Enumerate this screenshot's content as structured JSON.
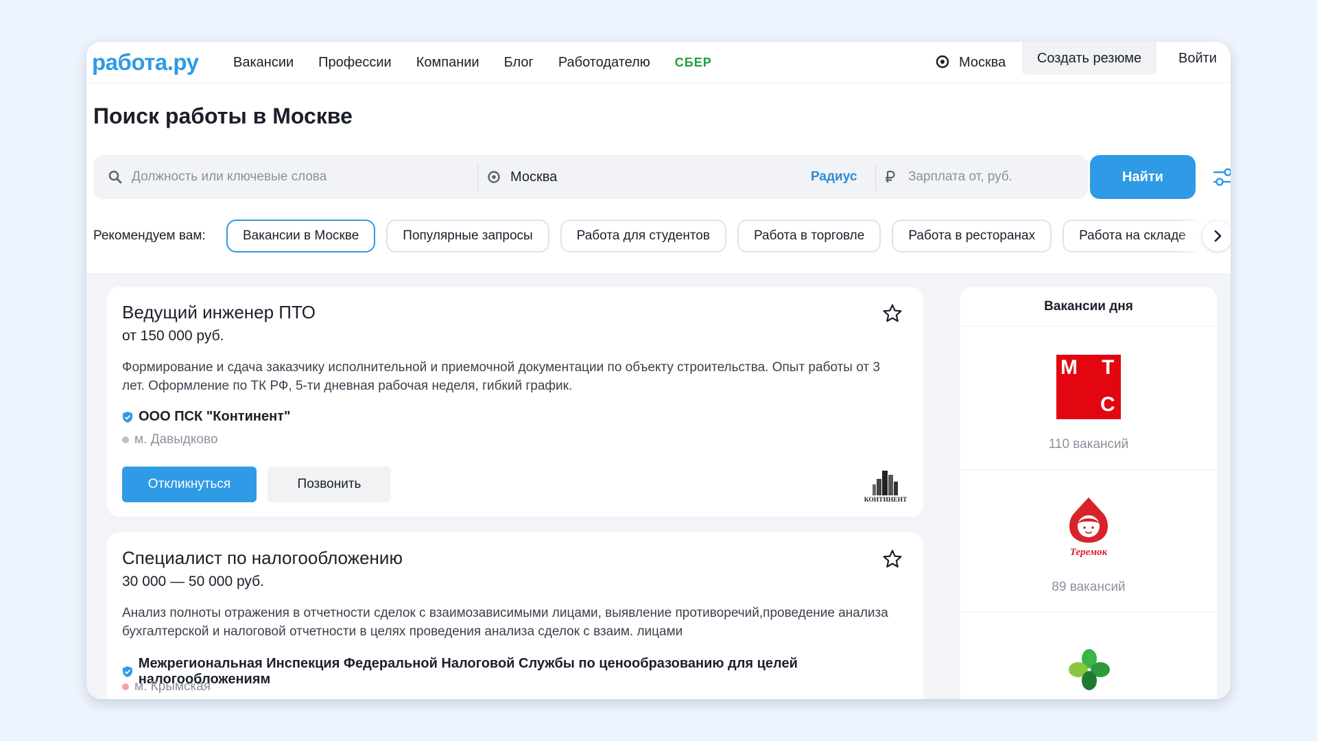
{
  "header": {
    "logo": "работа.ру",
    "nav": [
      "Вакансии",
      "Профессии",
      "Компании",
      "Блог",
      "Работодателю"
    ],
    "sber": "СБЕР",
    "city": "Москва",
    "create_resume": "Создать резюме",
    "login": "Войти"
  },
  "page_title": "Поиск работы в Москве",
  "search": {
    "query_placeholder": "Должность или ключевые слова",
    "location_value": "Москва",
    "radius_label": "Радиус",
    "salary_placeholder": "Зарплата от, руб.",
    "find_label": "Найти"
  },
  "recommend": {
    "label": "Рекомендуем вам:",
    "chips": [
      "Вакансии в Москве",
      "Популярные запросы",
      "Работа для студентов",
      "Работа в торговле",
      "Работа в ресторанах",
      "Работа на складе"
    ]
  },
  "jobs": [
    {
      "title": "Ведущий инженер ПТО",
      "salary": "от 150 000 руб.",
      "description": "Формирование и сдача заказчику исполнительной и приемочной документации по объекту строительства. Опыт работы от 3 лет. Оформление по ТК РФ, 5-ти дневная рабочая неделя, гибкий график.",
      "company": "ООО ПСК \"Континент\"",
      "metro": "м. Давыдково",
      "metro_color": "#b8c2cc",
      "apply_label": "Откликнуться",
      "call_label": "Позвонить",
      "logo_text": "КОНТИНЕНТ"
    },
    {
      "title": "Специалист по налогообложению",
      "salary": "30 000 — 50 000 руб.",
      "description": "Анализ полноты отражения в отчетности сделок с взаимозависимыми лицами, выявление противоречий,проведение анализа бухгалтерской и налоговой отчетности в целях проведения анализа сделок с взаим. лицами",
      "company": "Межрегиональная Инспекция Федеральной Налоговой Службы по ценообразованию для целей налогообложениям",
      "metro": "м. Крымская",
      "metro_color": "#f4a3a8"
    }
  ],
  "sidebar": {
    "title": "Вакансии дня",
    "items": [
      {
        "logo_letters": [
          "М",
          "Т",
          "С"
        ],
        "count": "110 вакансий"
      },
      {
        "logo_text": "Теремок",
        "count": "89 вакансий"
      }
    ]
  },
  "colors": {
    "accent": "#2f9ae6",
    "sber": "#21a038",
    "mts": "#e30611",
    "teremok": "#d8232a",
    "clover": "#3bb54a"
  }
}
